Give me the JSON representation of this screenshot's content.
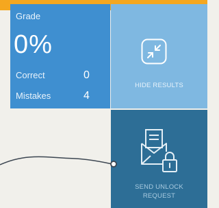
{
  "colors": {
    "accent_strip": "#f5a71f",
    "grade_tile": "#3f8fd0",
    "hide_tile": "#7fb8e1",
    "send_tile": "#2d6e96",
    "background": "#f1f0eb",
    "connector_line": "#3c4651"
  },
  "grade": {
    "label": "Grade",
    "value": "0%",
    "correct_label": "Correct",
    "correct_value": "0",
    "mistakes_label": "Mistakes",
    "mistakes_value": "4"
  },
  "hide_results": {
    "label": "HIDE RESULTS",
    "icon": "compress-arrows-icon"
  },
  "send_unlock": {
    "line1": "SEND UNLOCK",
    "line2": "REQUEST",
    "icon": "envelope-lock-icon"
  }
}
